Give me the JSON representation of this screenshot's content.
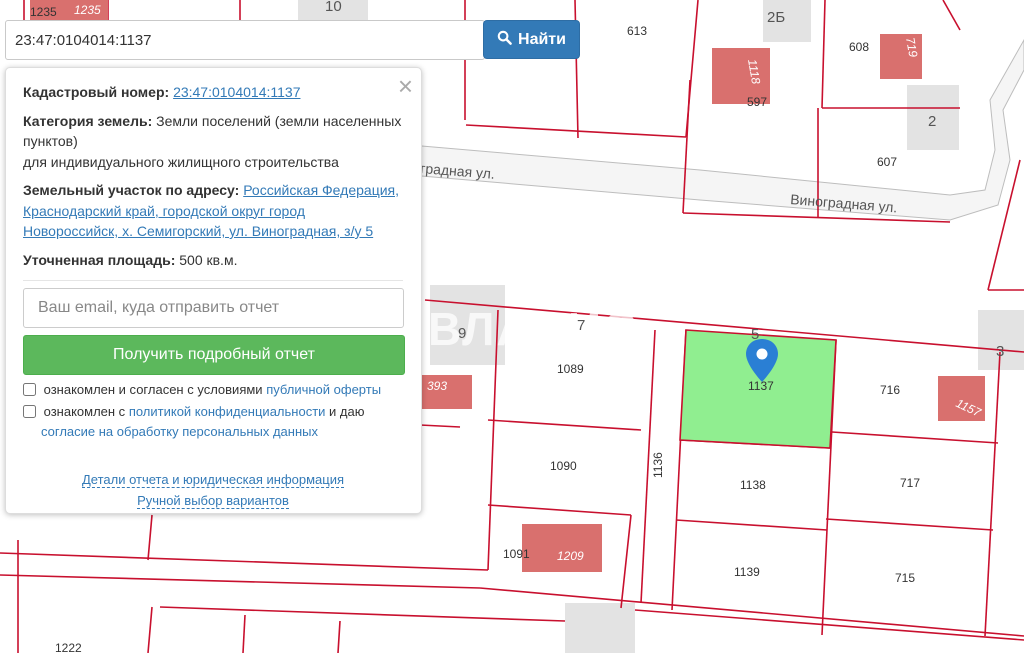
{
  "search": {
    "value": "23:47:0104014:1137",
    "button_label": "Найти",
    "button_icon": "search-icon",
    "button_color": "#337ab7"
  },
  "panel": {
    "close_label": "×",
    "cadastral_label": "Кадастровый номер:",
    "cadastral_value": "23:47:0104014:1137",
    "category_label": "Категория земель:",
    "category_value": "Земли поселений (земли населенных пунктов)",
    "category_use": "для индивидуального жилищного строительства",
    "address_label": "Земельный участок по адресу:",
    "address_value": "Российская Федерация, Краснодарский край, городской округ город Новороссийск, х. Семигорский, ул. Виноградная, з/у 5",
    "area_label": "Уточненная площадь:",
    "area_value": "500 кв.м.",
    "email_placeholder": "Ваш email, куда отправить отчет",
    "get_report_label": "Получить подробный отчет",
    "get_report_color": "#5cb85c",
    "consent1_text": "ознакомлен и согласен с условиями",
    "consent1_link": "публичной оферты",
    "consent2_text": "ознакомлен с",
    "consent2_link": "политикой конфиденциальности",
    "consent2_mid": "и даю",
    "consent2_link2": "согласие на обработку персональных данных",
    "details_link": "Детали отчета и юридическая информация",
    "manual_link": "Ручной выбор вариантов"
  },
  "map": {
    "street_left": "градная ул.",
    "street_right": "Виноградная ул.",
    "selected_plot": "1137",
    "selected_color": "#90ee90",
    "boundary_color": "#c8102e",
    "building_color": "#d9706e",
    "plot_numbers": [
      "1235",
      "613",
      "597",
      "608",
      "607",
      "1089",
      "716",
      "1090",
      "1136",
      "1138",
      "717",
      "1091",
      "1139",
      "715",
      "1222"
    ],
    "building_numbers": [
      "1235",
      "1118",
      "719",
      "393",
      "1157",
      "1209"
    ],
    "house_numbers": [
      "10",
      "2Б",
      "2",
      "9",
      "7",
      "5",
      "3"
    ],
    "watermark": "ВЛАДИС"
  }
}
